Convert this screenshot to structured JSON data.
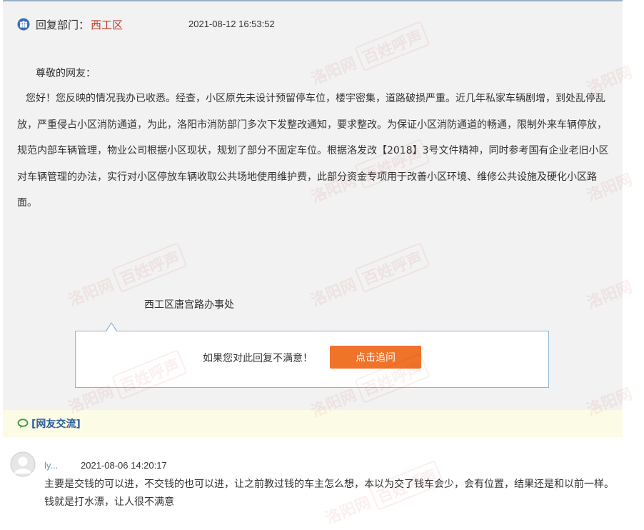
{
  "reply": {
    "dept_label": "回复部门：",
    "dept_name": "西工区",
    "time": "2021-08-12 16:53:52",
    "greeting": "尊敬的网友：",
    "body": "您好！您反映的情况我办已收悉。经查，小区原先未设计预留停车位，楼宇密集，道路破损严重。近几年私家车辆剧增，到处乱停乱放，严重侵占小区消防通道，为此，洛阳市消防部门多次下发整改通知，要求整改。为保证小区消防通道的畅通，限制外来车辆停放，规范内部车辆管理，物业公司根据小区现状，规划了部分不固定车位。根据洛发改【2018】3号文件精神，同时参考国有企业老旧小区对车辆管理的办法，实行对小区停放车辆收取公共场地使用维护费，此部分资金专项用于改善小区环境、维修公共设施及硬化小区路面。",
    "signature": "西工区唐宫路办事处"
  },
  "followup": {
    "prompt": "如果您对此回复不满意！",
    "button_label": "点击追问"
  },
  "exchange": {
    "title": "[网友交流]"
  },
  "comment": {
    "user": "ly...",
    "time": "2021-08-06 14:20:17",
    "text": "主要是交钱的可以进，不交钱的也可以进，让之前教过钱的车主怎么想，本以为交了钱车会少，会有位置，结果还是和以前一样。钱就是打水漂，让人很不满意"
  },
  "watermark": {
    "text_a": "洛阳网",
    "text_b": "百姓呼声"
  },
  "colors": {
    "accent_orange": "#f0732a",
    "dept_red": "#c0392b",
    "link_blue": "#2a5c9a",
    "user_blue": "#6b8fbf"
  },
  "icons": {
    "dept": "group-icon",
    "exchange": "speech-bubble-icon",
    "avatar": "default-avatar-icon"
  }
}
